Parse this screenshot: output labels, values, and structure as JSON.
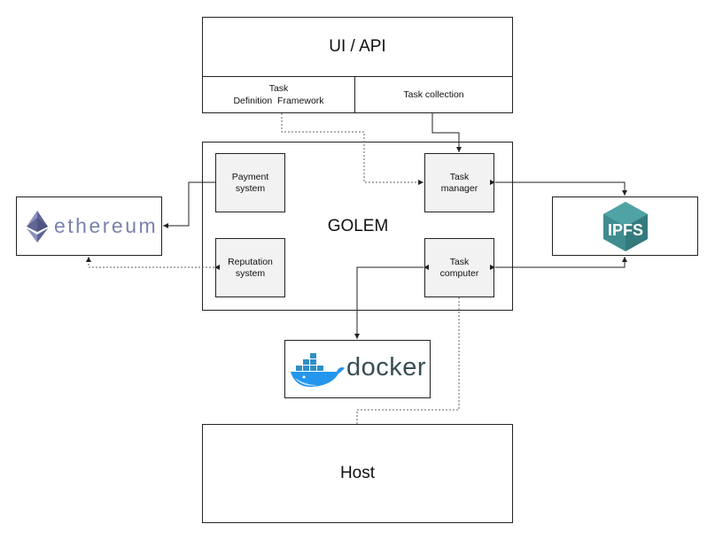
{
  "diagram": {
    "ui_api": {
      "title": "UI / API",
      "task_definition_framework": [
        "Task",
        "Definition  Framework"
      ],
      "task_collection": "Task collection"
    },
    "golem": {
      "title": "GOLEM",
      "payment_system": [
        "Payment",
        "system"
      ],
      "reputation_system": [
        "Reputation",
        "system"
      ],
      "task_manager": [
        "Task",
        "manager"
      ],
      "task_computer": [
        "Task",
        "computer"
      ]
    },
    "ethereum": {
      "label": "ethereum",
      "logo_color": "#6b73a3"
    },
    "ipfs": {
      "label": "IPFS",
      "logo_color": "#3f8c8f"
    },
    "docker": {
      "label": "docker",
      "whale_color": "#2496ed",
      "text_color": "#384d54"
    },
    "host": {
      "title": "Host"
    },
    "connections": [
      {
        "from": "task-definition-framework",
        "to": "task-manager",
        "style": "dotted"
      },
      {
        "from": "task-collection",
        "to": "task-manager",
        "style": "solid"
      },
      {
        "from": "payment-system",
        "to": "ethereum",
        "style": "solid"
      },
      {
        "from": "reputation-system",
        "to": "ethereum",
        "style": "dotted",
        "bidirectional": true
      },
      {
        "from": "task-manager",
        "to": "ipfs",
        "style": "solid",
        "bidirectional": true
      },
      {
        "from": "task-computer",
        "to": "ipfs",
        "style": "solid",
        "bidirectional": true
      },
      {
        "from": "task-computer",
        "to": "docker",
        "style": "solid",
        "bidirectional": true
      },
      {
        "from": "task-computer",
        "to": "host",
        "style": "dotted"
      }
    ]
  }
}
